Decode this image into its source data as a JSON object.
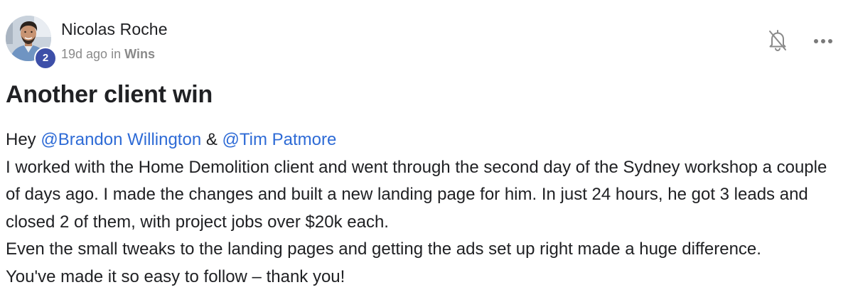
{
  "post": {
    "author": {
      "name": "Nicolas Roche",
      "level": "2",
      "avatar_icon": "user-avatar-photo"
    },
    "meta": {
      "time_ago": "19d ago",
      "in_word": "in",
      "category": "Wins"
    },
    "actions": {
      "notification_icon": "bell-off-icon",
      "more_icon": "more-horizontal-icon"
    },
    "title": "Another client win",
    "body": {
      "greeting": "Hey",
      "mention_1": "@Brandon Willington",
      "ampersand": "&",
      "mention_2": "@Tim Patmore",
      "paragraph_1": "I worked with the Home Demolition client and went through the second day of the Sydney workshop a couple of days ago. I made the changes and built a new landing page for him. In just 24 hours, he got 3 leads and closed 2 of them, with project jobs over $20k each.",
      "paragraph_2": "Even the small tweaks to the landing pages and getting the ads set up right made a huge difference.",
      "paragraph_3": "You've made it so easy to follow – thank you!"
    }
  },
  "colors": {
    "mention": "#2e6bd6",
    "badge": "#3d4fa8",
    "meta_text": "#8a8a8a",
    "text": "#202124"
  }
}
